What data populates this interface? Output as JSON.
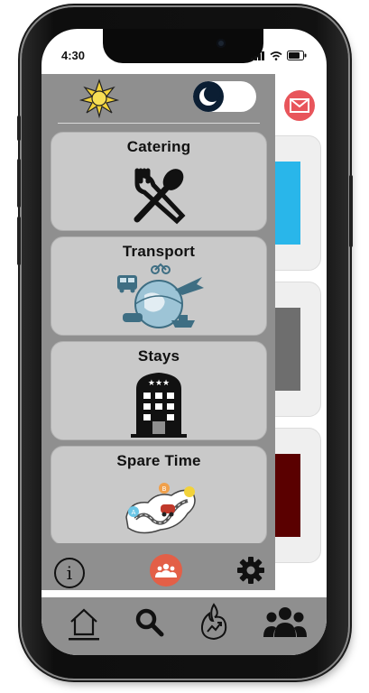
{
  "status_bar": {
    "time": "4:30"
  },
  "drawer": {
    "categories": [
      {
        "label": "Catering",
        "icon": "fork-spoon-icon"
      },
      {
        "label": "Transport",
        "icon": "transport-globe-icon"
      },
      {
        "label": "Stays",
        "icon": "hotel-building-icon"
      },
      {
        "label": "Spare Time",
        "icon": "map-route-icon"
      }
    ],
    "theme_toggle": {
      "state": "off",
      "icons": [
        "sun-icon",
        "moon-icon"
      ]
    },
    "footer": {
      "icons": [
        "info-icon",
        "group-icon",
        "gear-icon"
      ]
    }
  },
  "bottom_nav": {
    "items": [
      "home-icon",
      "search-icon",
      "trending-flame-icon",
      "people-icon"
    ]
  },
  "colors": {
    "drawer_bg": "#8f8f8f",
    "card_bg": "#c9c9c9",
    "mail_accent": "#e8555b",
    "group_badge": "#e35f47",
    "card_strip_1": "#29b6ea",
    "card_strip_2": "#6e6e6e",
    "card_strip_3": "#5a0000"
  }
}
